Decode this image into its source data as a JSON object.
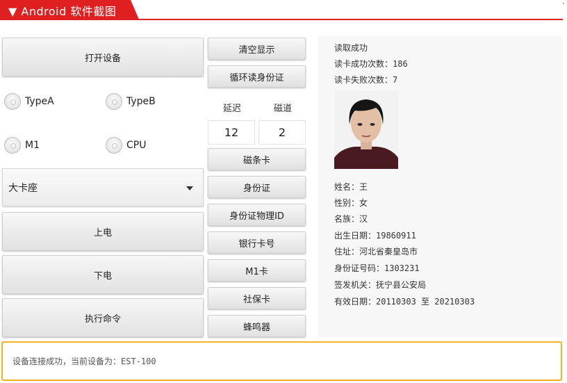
{
  "header": {
    "title": "▼ Android 软件截图"
  },
  "left_buttons": {
    "open_device": "打开设备",
    "power_on": "上电",
    "power_off": "下电",
    "execute_command": "执行命令"
  },
  "radio_options": [
    {
      "label": "TypeA"
    },
    {
      "label": "TypeB"
    },
    {
      "label": "M1"
    },
    {
      "label": "CPU"
    }
  ],
  "card_slot": {
    "selected": "大卡座"
  },
  "mid_buttons": {
    "clear_display": "清空显示",
    "loop_read_id": "循环读身份证",
    "magnetic_card": "磁条卡",
    "id_card": "身份证",
    "id_physical": "身份证物理ID",
    "bank_card": "银行卡号",
    "m1_card": "M1卡",
    "social_card": "社保卡",
    "buzzer": "蜂鸣器"
  },
  "params": {
    "delay_label": "延迟",
    "track_label": "磁道",
    "delay_value": "12",
    "track_value": "2"
  },
  "result": {
    "status": "读取成功",
    "success_count": "读卡成功次数：186",
    "fail_count": "读卡失败次数：7",
    "name": "姓名：王",
    "gender": "性别：女",
    "ethnicity": "名族：汉",
    "birth": "出生日期：19860911",
    "address": "住址：河北省秦皇岛市",
    "id_number": "身份证号码：1303231",
    "issuer": "签发机关：抚宁县公安局",
    "valid_period": "有效日期：20110303 至 20210303"
  },
  "status_bar": {
    "message": "设备连接成功，当前设备为：EST-100"
  },
  "colors": {
    "title_red": "#e02020",
    "status_border": "#f5b120"
  }
}
